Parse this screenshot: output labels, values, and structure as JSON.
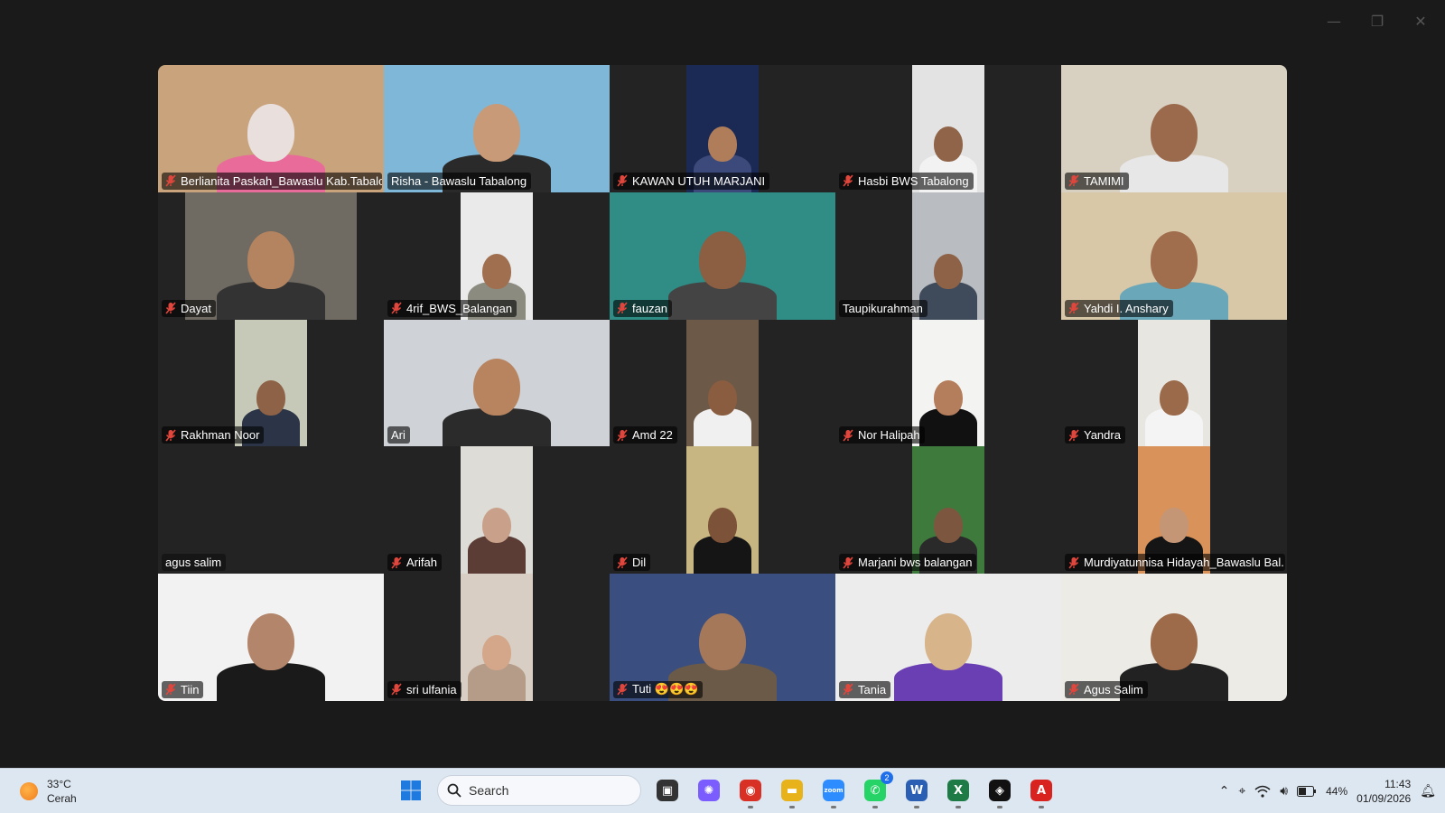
{
  "window": {
    "minimize": "—",
    "restore": "❐",
    "close": "✕"
  },
  "participants": [
    {
      "name": "Berlianita Paskah_Bawaslu Kab.Tabalo...",
      "muted": true,
      "bg": "#c9a37c",
      "skin": "#e9e0de",
      "shirt": "#e86b9a"
    },
    {
      "name": "Risha - Bawaslu Tabalong",
      "muted": false,
      "active": true,
      "bg": "#7fb7d8",
      "skin": "#c99a78",
      "shirt": "#2a2a2a"
    },
    {
      "name": "KAWAN UTUH MARJANI",
      "muted": true,
      "bg": "#1b2a55",
      "skin": "#b07d5a",
      "shirt": "#3b4a7a"
    },
    {
      "name": "Hasbi BWS Tabalong",
      "muted": true,
      "bg": "#e3e3e3",
      "skin": "#8f6448",
      "shirt": "#f2f2f2"
    },
    {
      "name": "TAMIMI",
      "muted": true,
      "bg": "#d8d0c0",
      "skin": "#9b6a4d",
      "shirt": "#e7e7e7"
    },
    {
      "name": "Dayat",
      "muted": true,
      "bg": "#6f6a62",
      "skin": "#b4835f",
      "shirt": "#333333"
    },
    {
      "name": "4rif_BWS_Balangan",
      "muted": true,
      "bg": "#eaeaea",
      "skin": "#a06f4f",
      "shirt": "#8b8b80"
    },
    {
      "name": "fauzan",
      "muted": true,
      "bg": "#2f8d86",
      "skin": "#8c5e42",
      "shirt": "#444444"
    },
    {
      "name": "Taupikurahman",
      "muted": false,
      "bg": "#b9bcc0",
      "skin": "#8e6246",
      "shirt": "#3f4a5a"
    },
    {
      "name": "Yahdi I. Anshary",
      "muted": true,
      "bg": "#d9c8a8",
      "skin": "#a06d4d",
      "shirt": "#6aa7b8"
    },
    {
      "name": "Rakhman Noor",
      "muted": true,
      "bg": "#c7c9b8",
      "skin": "#8d6246",
      "shirt": "#2c3548"
    },
    {
      "name": "Ari",
      "muted": false,
      "bg": "#cfd2d6",
      "skin": "#b88460",
      "shirt": "#2b2b2b"
    },
    {
      "name": "Amd 22",
      "muted": true,
      "bg": "#6d5948",
      "skin": "#8a5d40",
      "shirt": "#f0f0f0"
    },
    {
      "name": "Nor Halipah",
      "muted": true,
      "bg": "#f3f3f1",
      "skin": "#b47d5b",
      "shirt": "#111111"
    },
    {
      "name": "Yandra",
      "muted": true,
      "bg": "#e8e6e0",
      "skin": "#9b6a4b",
      "shirt": "#f4f4f4"
    },
    {
      "name": "agus salim",
      "muted": false,
      "camera_off": true
    },
    {
      "name": "Arifah",
      "muted": true,
      "bg": "#dedcd6",
      "skin": "#c9a08a",
      "shirt": "#5b3d36"
    },
    {
      "name": "Dil",
      "muted": true,
      "bg": "#c8b682",
      "skin": "#7c5238",
      "shirt": "#151515"
    },
    {
      "name": "Marjani bws balangan",
      "muted": true,
      "bg": "#3f7a3d",
      "skin": "#7d5640",
      "shirt": "#2a2a2a"
    },
    {
      "name": "Murdiyatunnisa Hidayah_Bawaslu Bal...",
      "muted": true,
      "bg": "#d9925a",
      "skin": "#c49676",
      "shirt": "#151515"
    },
    {
      "name": "Tiin",
      "muted": true,
      "bg": "#f2f2f2",
      "skin": "#b3856a",
      "shirt": "#1a1a1a"
    },
    {
      "name": "sri ulfania",
      "muted": true,
      "bg": "#d8cec3",
      "skin": "#d4a78a",
      "shirt": "#b49c88"
    },
    {
      "name": "Tuti 😍😍😍",
      "muted": true,
      "bg": "#3a4f7f",
      "skin": "#a6785a",
      "shirt": "#6b5a48"
    },
    {
      "name": "Tania",
      "muted": true,
      "bg": "#ececec",
      "skin": "#d7b48a",
      "shirt": "#6a3fb3"
    },
    {
      "name": "Agus Salim",
      "muted": true,
      "bg": "#ecebe6",
      "skin": "#9d6a4a",
      "shirt": "#222222"
    }
  ],
  "taskbar": {
    "weather_temp": "33°C",
    "weather_desc": "Cerah",
    "search_label": "Search",
    "apps": [
      {
        "icon": "task-view-icon",
        "glyph": "▣",
        "color": "#333333"
      },
      {
        "icon": "copilot-icon",
        "glyph": "✺",
        "color": "#7a5cff"
      },
      {
        "icon": "chrome-icon",
        "glyph": "◉",
        "color": "#d93025"
      },
      {
        "icon": "file-explorer-icon",
        "glyph": "▬",
        "color": "#e8b31a"
      },
      {
        "icon": "zoom-icon",
        "glyph": "zoom",
        "color": "#2d8cff"
      },
      {
        "icon": "whatsapp-icon",
        "glyph": "✆",
        "color": "#25d366",
        "badge": "2"
      },
      {
        "icon": "word-icon",
        "glyph": "W",
        "color": "#2b5fb4"
      },
      {
        "icon": "excel-icon",
        "glyph": "X",
        "color": "#1e7b45"
      },
      {
        "icon": "capcut-icon",
        "glyph": "◈",
        "color": "#111111"
      },
      {
        "icon": "acrobat-icon",
        "glyph": "A",
        "color": "#d9231f"
      }
    ],
    "battery": "44%",
    "time": "11:43",
    "date": "01/09/2026"
  }
}
